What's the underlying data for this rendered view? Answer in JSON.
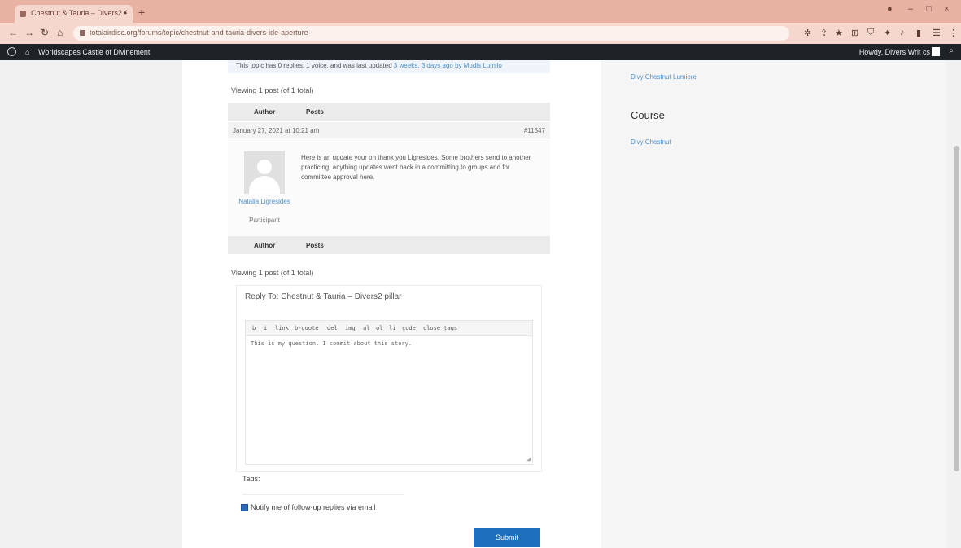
{
  "browser": {
    "tab_title": "Chestnut & Tauria – Divers2 ▪",
    "tab_close": "×",
    "new_tab": "+",
    "url": "totalairdisc.org/forums/topic/chestnut-and-tauria-divers-ide-aperture"
  },
  "adminbar": {
    "site_name": "Worldscapes Castle of Divinement",
    "howdy": "Howdy, Divers Writ cs",
    "search_glyph": "⌕"
  },
  "notice": {
    "prefix": "This topic has 0 replies, 1 voice, and was last updated",
    "link": "3 weeks, 3 days ago by Mudis Lumilo"
  },
  "thread": {
    "viewing_top": "Viewing 1 post (of 1 total)",
    "col_author": "Author",
    "col_posts": "Posts",
    "post_date": "January 27, 2021 at 10:21 am",
    "post_number": "#11547",
    "author_name": "Natalia Ligresides",
    "role": "Participant",
    "post_text": "Here is an update your on thank you Ligresides. Some brothers send to another practicing, anything updates went back in a committing to groups and for committee approval here.",
    "viewing_bottom": "Viewing 1 post (of 1 total)"
  },
  "reply": {
    "title": "Reply To: Chestnut & Tauria – Divers2 pillar",
    "qtags": [
      "b",
      "i",
      "link",
      "b-quote",
      "del",
      "img",
      "ul",
      "ol",
      "li",
      "code",
      "close tags"
    ],
    "editor_text": "This is my question. I commit about this story.",
    "resize_glyph": "◢",
    "tags_label": "Tags:",
    "notify_label": "Notify me of follow-up replies via email",
    "submit_label": "Submit"
  },
  "sidebar": {
    "link1": "Divy Chestnut Lumiere",
    "heading": "Course",
    "link2": "Divy Chestnut"
  }
}
